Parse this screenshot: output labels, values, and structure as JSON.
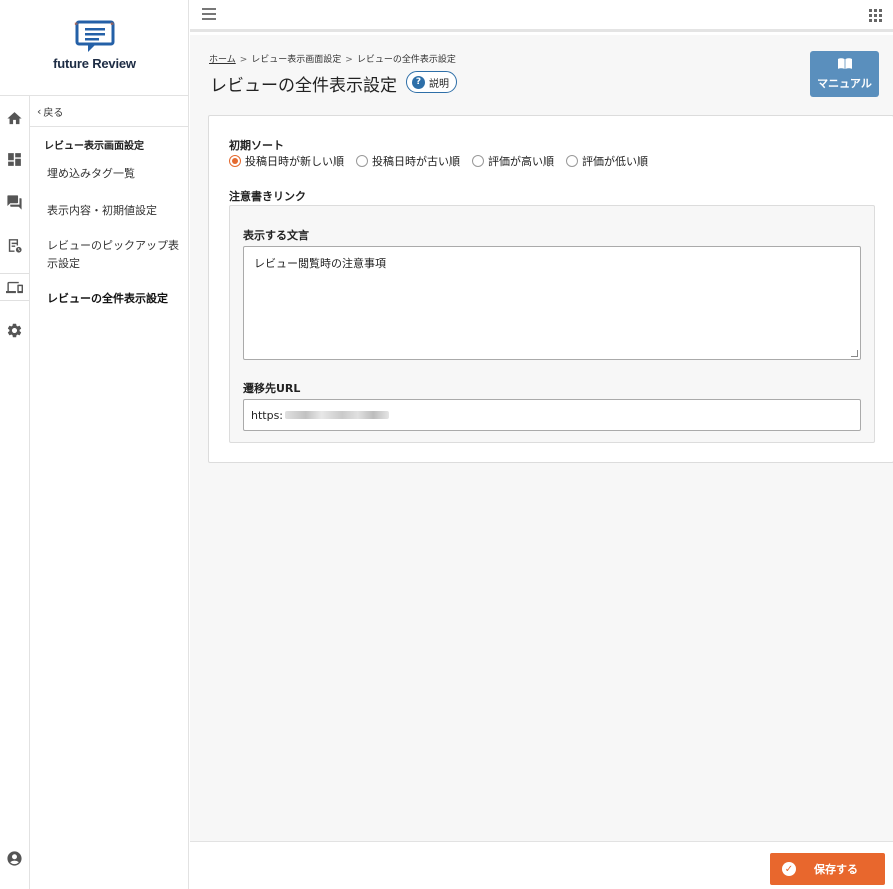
{
  "logo": {
    "text": "future Review"
  },
  "rail": {
    "icons": [
      "home-icon",
      "dashboard-icon",
      "chat-icon",
      "report-icon",
      "devices-icon",
      "gear-icon",
      "account-icon"
    ]
  },
  "sidebar": {
    "back_label": "戻る",
    "section_title": "レビュー表示画面設定",
    "items": [
      {
        "label": "埋め込みタグ一覧"
      },
      {
        "label": "表示内容・初期値設定"
      },
      {
        "label": "レビューのピックアップ表示設定"
      },
      {
        "label": "レビューの全件表示設定"
      }
    ]
  },
  "breadcrumb": {
    "items": [
      "ホーム",
      "レビュー表示画面設定",
      "レビューの全件表示設定"
    ],
    "separator": ">"
  },
  "page": {
    "title": "レビューの全件表示設定",
    "help_label": "説明",
    "manual_label": "マニュアル"
  },
  "form": {
    "sort_label": "初期ソート",
    "sort_options": [
      {
        "label": "投稿日時が新しい順",
        "selected": true
      },
      {
        "label": "投稿日時が古い順",
        "selected": false
      },
      {
        "label": "評価が高い順",
        "selected": false
      },
      {
        "label": "評価が低い順",
        "selected": false
      }
    ],
    "note_link_label": "注意書きリンク",
    "display_text_label": "表示する文言",
    "display_text_value": "レビュー閲覧時の注意事項",
    "url_label": "遷移先URL",
    "url_value_prefix": "https:"
  },
  "footer": {
    "save_label": "保存する"
  },
  "colors": {
    "accent": "#e8672d",
    "manual": "#5a8fbd",
    "help": "#2e6fa8"
  }
}
